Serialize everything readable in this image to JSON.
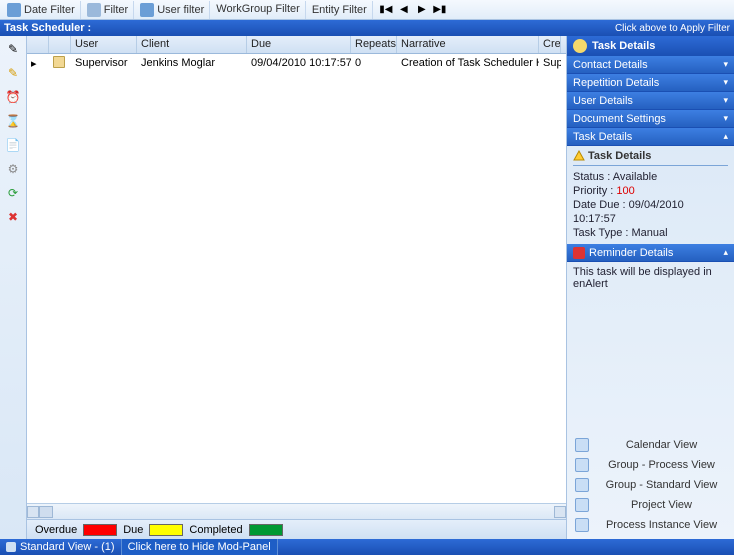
{
  "toolbar": {
    "date_filter": "Date Filter",
    "filter": "Filter",
    "user_filter": "User filter",
    "workgroup_filter": "WorkGroup Filter",
    "entity_filter": "Entity Filter"
  },
  "header": {
    "title": "Task Scheduler :",
    "apply": "Click above to Apply Filter"
  },
  "grid": {
    "cols": {
      "user": "User",
      "client": "Client",
      "due": "Due",
      "repeats": "Repeats",
      "narrative": "Narrative",
      "created": "Cre"
    },
    "rows": [
      {
        "user": "Supervisor",
        "client": "Jenkins Moglar",
        "due": "09/04/2010 10:17:57",
        "repeats": "0",
        "narrative": "Creation of Task Scheduler Help Files",
        "created": "Sup"
      }
    ]
  },
  "legend": {
    "overdue": "Overdue",
    "due": "Due",
    "completed": "Completed",
    "colors": {
      "overdue": "#ff0000",
      "due": "#ffff00",
      "completed": "#009933"
    }
  },
  "right": {
    "title": "Task Details",
    "accordions": {
      "contact": "Contact Details",
      "repetition": "Repetition Details",
      "user": "User Details",
      "document": "Document Settings",
      "task": "Task Details",
      "reminder": "Reminder Details"
    },
    "task_panel": {
      "heading": "Task Details",
      "status_label": "Status :",
      "status": "Available",
      "priority_label": "Priority :",
      "priority": "100",
      "date_due_label": "Date Due :",
      "date_due": "09/04/2010 10:17:57",
      "task_type_label": "Task Type :",
      "task_type": "Manual"
    },
    "reminder_text": "This task will be displayed in enAlert",
    "views": {
      "calendar": "Calendar View",
      "group_process": "Group - Process View",
      "group_standard": "Group - Standard View",
      "project": "Project View",
      "process_instance": "Process Instance View"
    }
  },
  "status": {
    "view": "Standard View - (1)",
    "mod_panel": "Click here to Hide Mod-Panel"
  }
}
